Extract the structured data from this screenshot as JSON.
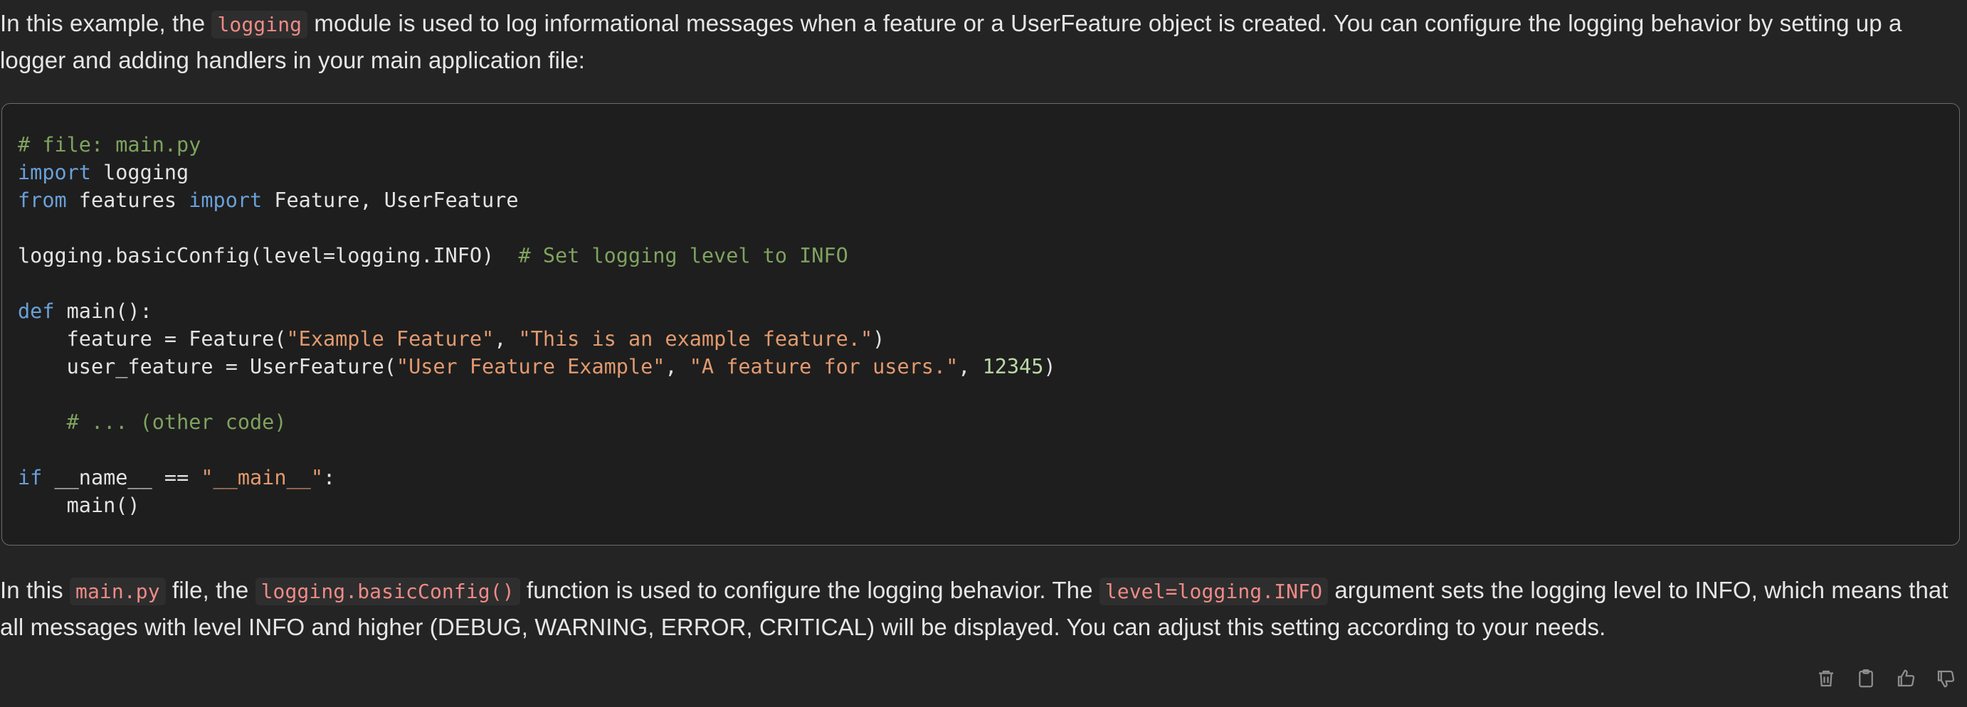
{
  "intro": {
    "before": "In this example, the ",
    "code1": "logging",
    "after": " module is used to log informational messages when a feature or a UserFeature object is created. You can configure the logging behavior by setting up a logger and adding handlers in your main application file:"
  },
  "code_block": {
    "language": "python",
    "lines": [
      [
        {
          "t": "cm",
          "v": "# file: main.py"
        }
      ],
      [
        {
          "t": "kw",
          "v": "import"
        },
        {
          "t": "pl",
          "v": " logging"
        }
      ],
      [
        {
          "t": "kw",
          "v": "from"
        },
        {
          "t": "pl",
          "v": " features "
        },
        {
          "t": "kw",
          "v": "import"
        },
        {
          "t": "pl",
          "v": " Feature, UserFeature"
        }
      ],
      [],
      [
        {
          "t": "pl",
          "v": "logging.basicConfig(level=logging.INFO)  "
        },
        {
          "t": "cm",
          "v": "# Set logging level to INFO"
        }
      ],
      [],
      [
        {
          "t": "kw",
          "v": "def"
        },
        {
          "t": "pl",
          "v": " main():"
        }
      ],
      [
        {
          "t": "pl",
          "v": "    feature = Feature("
        },
        {
          "t": "st",
          "v": "\"Example Feature\""
        },
        {
          "t": "pl",
          "v": ", "
        },
        {
          "t": "st",
          "v": "\"This is an example feature.\""
        },
        {
          "t": "pl",
          "v": ")"
        }
      ],
      [
        {
          "t": "pl",
          "v": "    user_feature = UserFeature("
        },
        {
          "t": "st",
          "v": "\"User Feature Example\""
        },
        {
          "t": "pl",
          "v": ", "
        },
        {
          "t": "st",
          "v": "\"A feature for users.\""
        },
        {
          "t": "pl",
          "v": ", "
        },
        {
          "t": "nm",
          "v": "12345"
        },
        {
          "t": "pl",
          "v": ")"
        }
      ],
      [],
      [
        {
          "t": "pl",
          "v": "    "
        },
        {
          "t": "cm",
          "v": "# ... (other code)"
        }
      ],
      [],
      [
        {
          "t": "kw",
          "v": "if"
        },
        {
          "t": "pl",
          "v": " __name__ == "
        },
        {
          "t": "st",
          "v": "\"__main__\""
        },
        {
          "t": "pl",
          "v": ":"
        }
      ],
      [
        {
          "t": "pl",
          "v": "    main()"
        }
      ]
    ]
  },
  "outro": {
    "p1": "In this ",
    "code1": "main.py",
    "p2": " file, the ",
    "code2": "logging.basicConfig()",
    "p3": " function is used to configure the logging behavior. The ",
    "code3": "level=logging.INFO",
    "p4": " argument sets the logging level to INFO, which means that all messages with level INFO and higher (DEBUG, WARNING, ERROR, CRITICAL) will be displayed. You can adjust this setting according to your needs."
  },
  "actions": [
    {
      "name": "delete-button",
      "icon": "trash-icon"
    },
    {
      "name": "copy-button",
      "icon": "clipboard-icon"
    },
    {
      "name": "thumbs-up-button",
      "icon": "thumbs-up-icon"
    },
    {
      "name": "thumbs-down-button",
      "icon": "thumbs-down-icon"
    }
  ]
}
